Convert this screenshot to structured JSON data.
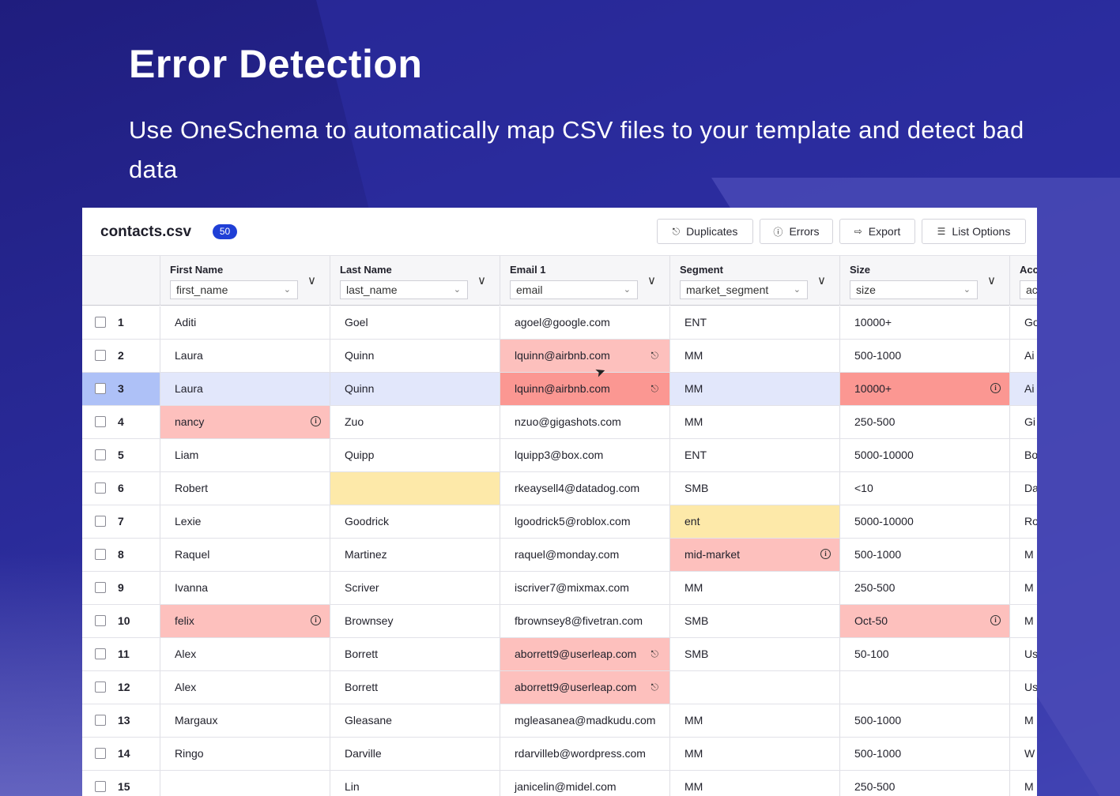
{
  "hero": {
    "title": "Error Detection",
    "subtitle": "Use OneSchema to automatically map CSV files to your template and detect bad data"
  },
  "toolbar": {
    "file_name": "contacts.csv",
    "row_count": "50",
    "duplicates_label": "Duplicates",
    "errors_label": "Errors",
    "export_label": "Export",
    "list_options_label": "List Options"
  },
  "colors": {
    "error": "#fdc0bd",
    "error_strong": "#fb9792",
    "missing": "#fde9a9",
    "selected_row": "#e2e7fb",
    "selected_index": "#aec1f7",
    "brand": "#1f3fd6"
  },
  "columns": [
    {
      "name": "First Name",
      "mapping": "first_name"
    },
    {
      "name": "Last Name",
      "mapping": "last_name"
    },
    {
      "name": "Email 1",
      "mapping": "email"
    },
    {
      "name": "Segment",
      "mapping": "market_segment"
    },
    {
      "name": "Size",
      "mapping": "size"
    },
    {
      "name": "Acc",
      "mapping": "ac"
    }
  ],
  "rows": [
    {
      "n": "1",
      "cells": [
        "Aditi",
        "Goel",
        "agoel@google.com",
        "ENT",
        "10000+",
        "Go"
      ]
    },
    {
      "n": "2",
      "cells": [
        "Laura",
        "Quinn",
        "lquinn@airbnb.com",
        "MM",
        "500-1000",
        "Ai"
      ]
    },
    {
      "n": "3",
      "cells": [
        "Laura",
        "Quinn",
        "lquinn@airbnb.com",
        "MM",
        "10000+",
        "Ai"
      ]
    },
    {
      "n": "4",
      "cells": [
        "nancy",
        "Zuo",
        "nzuo@gigashots.com",
        "MM",
        "250-500",
        "Gi"
      ]
    },
    {
      "n": "5",
      "cells": [
        "Liam",
        "Quipp",
        "lquipp3@box.com",
        "ENT",
        "5000-10000",
        "Bo"
      ]
    },
    {
      "n": "6",
      "cells": [
        "Robert",
        "",
        "rkeaysell4@datadog.com",
        "SMB",
        "<10",
        "Da"
      ]
    },
    {
      "n": "7",
      "cells": [
        "Lexie",
        "Goodrick",
        "lgoodrick5@roblox.com",
        "ent",
        "5000-10000",
        "Ro"
      ]
    },
    {
      "n": "8",
      "cells": [
        "Raquel",
        "Martinez",
        "raquel@monday.com",
        "mid-market",
        "500-1000",
        "M"
      ]
    },
    {
      "n": "9",
      "cells": [
        "Ivanna",
        "Scriver",
        "iscriver7@mixmax.com",
        "MM",
        "250-500",
        "M"
      ]
    },
    {
      "n": "10",
      "cells": [
        "felix",
        "Brownsey",
        "fbrownsey8@fivetran.com",
        "SMB",
        "Oct-50",
        "M"
      ]
    },
    {
      "n": "11",
      "cells": [
        "Alex",
        "Borrett",
        "aborrett9@userleap.com",
        "SMB",
        "50-100",
        "Us"
      ]
    },
    {
      "n": "12",
      "cells": [
        "Alex",
        "Borrett",
        "aborrett9@userleap.com",
        "",
        "",
        "Us"
      ]
    },
    {
      "n": "13",
      "cells": [
        "Margaux",
        "Gleasane",
        "mgleasanea@madkudu.com",
        "MM",
        "500-1000",
        "M"
      ]
    },
    {
      "n": "14",
      "cells": [
        "Ringo",
        "Darville",
        "rdarvilleb@wordpress.com",
        "MM",
        "500-1000",
        "W"
      ]
    },
    {
      "n": "15",
      "cells": [
        "",
        "Lin",
        "janicelin@midel.com",
        "MM",
        "250-500",
        "M"
      ]
    }
  ],
  "cell_flags": [
    {
      "row": 1,
      "col": 2,
      "status": "duplicate"
    },
    {
      "row": 2,
      "col": 2,
      "status": "duplicate-strong"
    },
    {
      "row": 2,
      "col": 4,
      "status": "error-strong"
    },
    {
      "row": 3,
      "col": 0,
      "status": "error"
    },
    {
      "row": 5,
      "col": 1,
      "status": "missing"
    },
    {
      "row": 6,
      "col": 3,
      "status": "missing"
    },
    {
      "row": 7,
      "col": 3,
      "status": "error"
    },
    {
      "row": 9,
      "col": 0,
      "status": "error"
    },
    {
      "row": 9,
      "col": 4,
      "status": "error"
    },
    {
      "row": 10,
      "col": 2,
      "status": "duplicate"
    },
    {
      "row": 11,
      "col": 2,
      "status": "duplicate"
    }
  ],
  "selected_row": 2
}
